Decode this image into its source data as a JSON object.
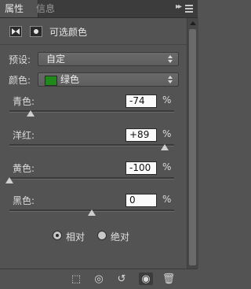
{
  "tabs": [
    {
      "label": "属性",
      "active": true
    },
    {
      "label": "信息",
      "active": false
    }
  ],
  "panel_menu": {
    "collapse_glyph": "▸▸",
    "menu_icon": "panel-menu-icon"
  },
  "adjustment": {
    "title": "可选颜色",
    "icon": "selective-color-icon",
    "mask_icon": "layer-mask-icon"
  },
  "preset": {
    "label": "预设:",
    "value": "自定"
  },
  "color": {
    "label": "颜色:",
    "value": "绿色",
    "swatch": "#1f8a1b"
  },
  "sliders": [
    {
      "label": "青色:",
      "value": "-74",
      "unit": "%",
      "numeric": -74
    },
    {
      "label": "洋红:",
      "value": "+89",
      "unit": "%",
      "numeric": 89
    },
    {
      "label": "黄色:",
      "value": "-100",
      "unit": "%",
      "numeric": -100
    },
    {
      "label": "黑色:",
      "value": "0",
      "unit": "%",
      "numeric": 0
    }
  ],
  "method": {
    "options": [
      {
        "label": "相对",
        "selected": true
      },
      {
        "label": "绝对",
        "selected": false
      }
    ]
  },
  "toolbar": {
    "buttons": [
      {
        "icon": "clip-to-layer-icon",
        "glyph": "⬚"
      },
      {
        "icon": "view-previous-state-icon",
        "glyph": "◎"
      },
      {
        "icon": "reset-icon",
        "glyph": "↺"
      },
      {
        "icon": "visibility-eye-icon",
        "glyph": "◉",
        "active": true
      },
      {
        "icon": "trash-icon",
        "glyph": "🗑"
      }
    ]
  },
  "colors": {
    "panel": "#535353",
    "tabbar": "#3c3c3c",
    "field": "#fafafa"
  }
}
